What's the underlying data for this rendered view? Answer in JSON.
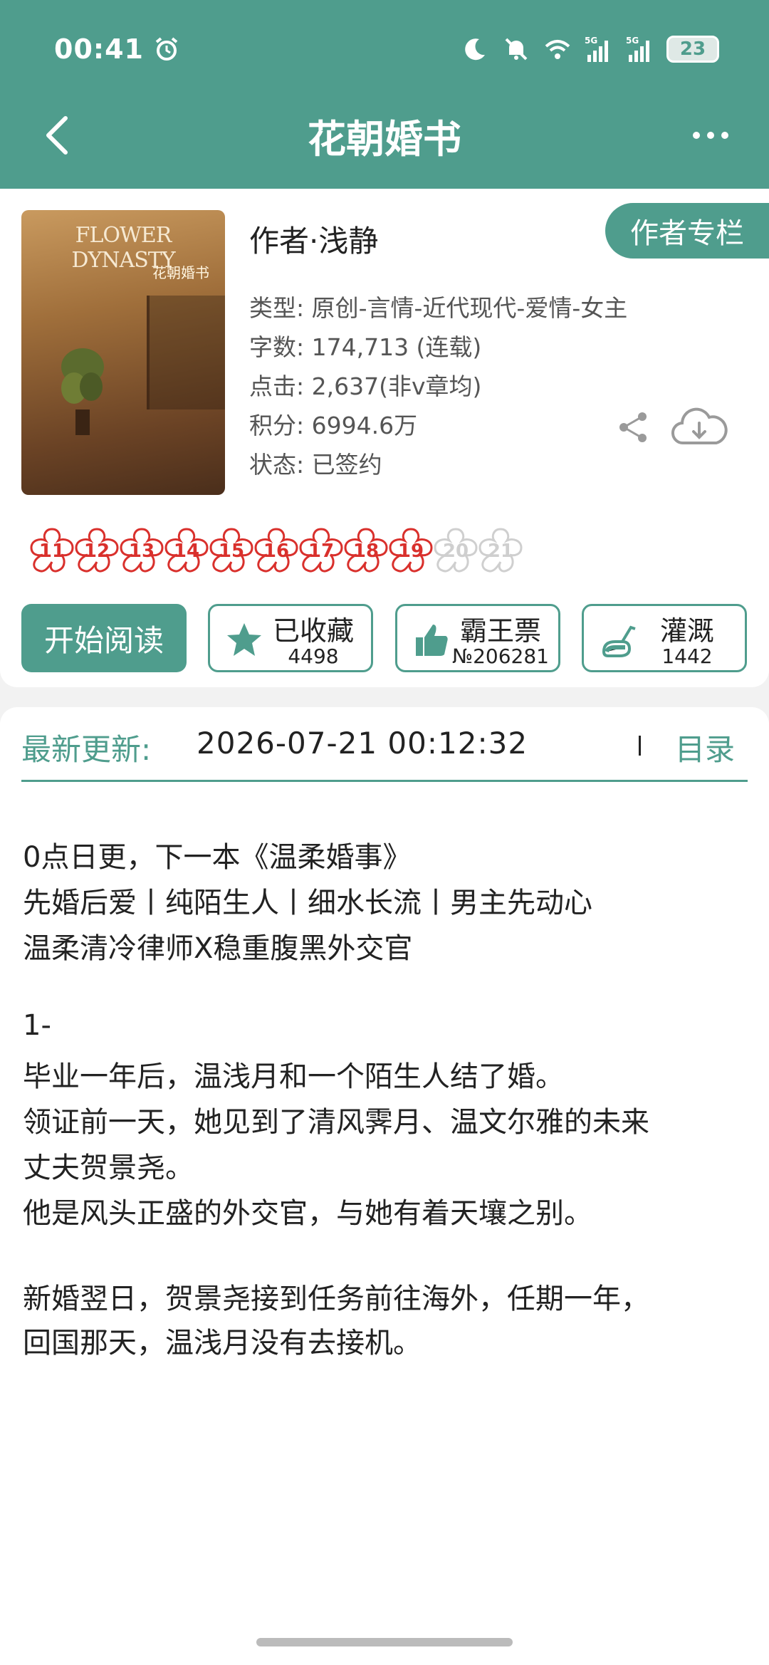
{
  "status_bar": {
    "time": "00:41",
    "battery": "23"
  },
  "header": {
    "title": "花朝婚书"
  },
  "book": {
    "cover_title": "FLOWER DYNASTY",
    "cover_cn": "花朝婚书",
    "author_label": "作者·浅静",
    "author_column_button": "作者专栏",
    "meta": [
      "类型: 原创-言情-近代现代-爱情-女主",
      "字数: 174,713 (连载)",
      "点击: 2,637(非v章均)",
      "积分: 6994.6万",
      "状态: 已签约"
    ]
  },
  "flowers": [
    {
      "num": "11",
      "active": true
    },
    {
      "num": "12",
      "active": true
    },
    {
      "num": "13",
      "active": true
    },
    {
      "num": "14",
      "active": true
    },
    {
      "num": "15",
      "active": true
    },
    {
      "num": "16",
      "active": true
    },
    {
      "num": "17",
      "active": true
    },
    {
      "num": "18",
      "active": true
    },
    {
      "num": "19",
      "active": true
    },
    {
      "num": "20",
      "active": false
    },
    {
      "num": "21",
      "active": false
    }
  ],
  "actions": {
    "read": "开始阅读",
    "collect": {
      "label": "已收藏",
      "count": "4498"
    },
    "ticket": {
      "label": "霸王票",
      "count": "№206281"
    },
    "water": {
      "label": "灌溉",
      "count": "1442"
    }
  },
  "update": {
    "label": "最新更新:",
    "date": "2026-07-21 00:12:32",
    "toc": "目录"
  },
  "description": [
    "0点日更，下一本《温柔婚事》",
    "先婚后爱丨纯陌生人丨细水长流丨男主先动心",
    "温柔清冷律师X稳重腹黑外交官",
    "1-",
    "毕业一年后，温浅月和一个陌生人结了婚。",
    "领证前一天，她见到了清风霁月、温文尔雅的未来",
    "丈夫贺景尧。",
    "他是风头正盛的外交官，与她有着天壤之别。",
    "新婚翌日，贺景尧接到任务前往海外，任期一年，",
    "回国那天，温浅月没有去接机。"
  ],
  "colors": {
    "accent": "#4f9d8d",
    "flower_active": "#d9302c",
    "flower_inactive": "#cfcfcf"
  }
}
